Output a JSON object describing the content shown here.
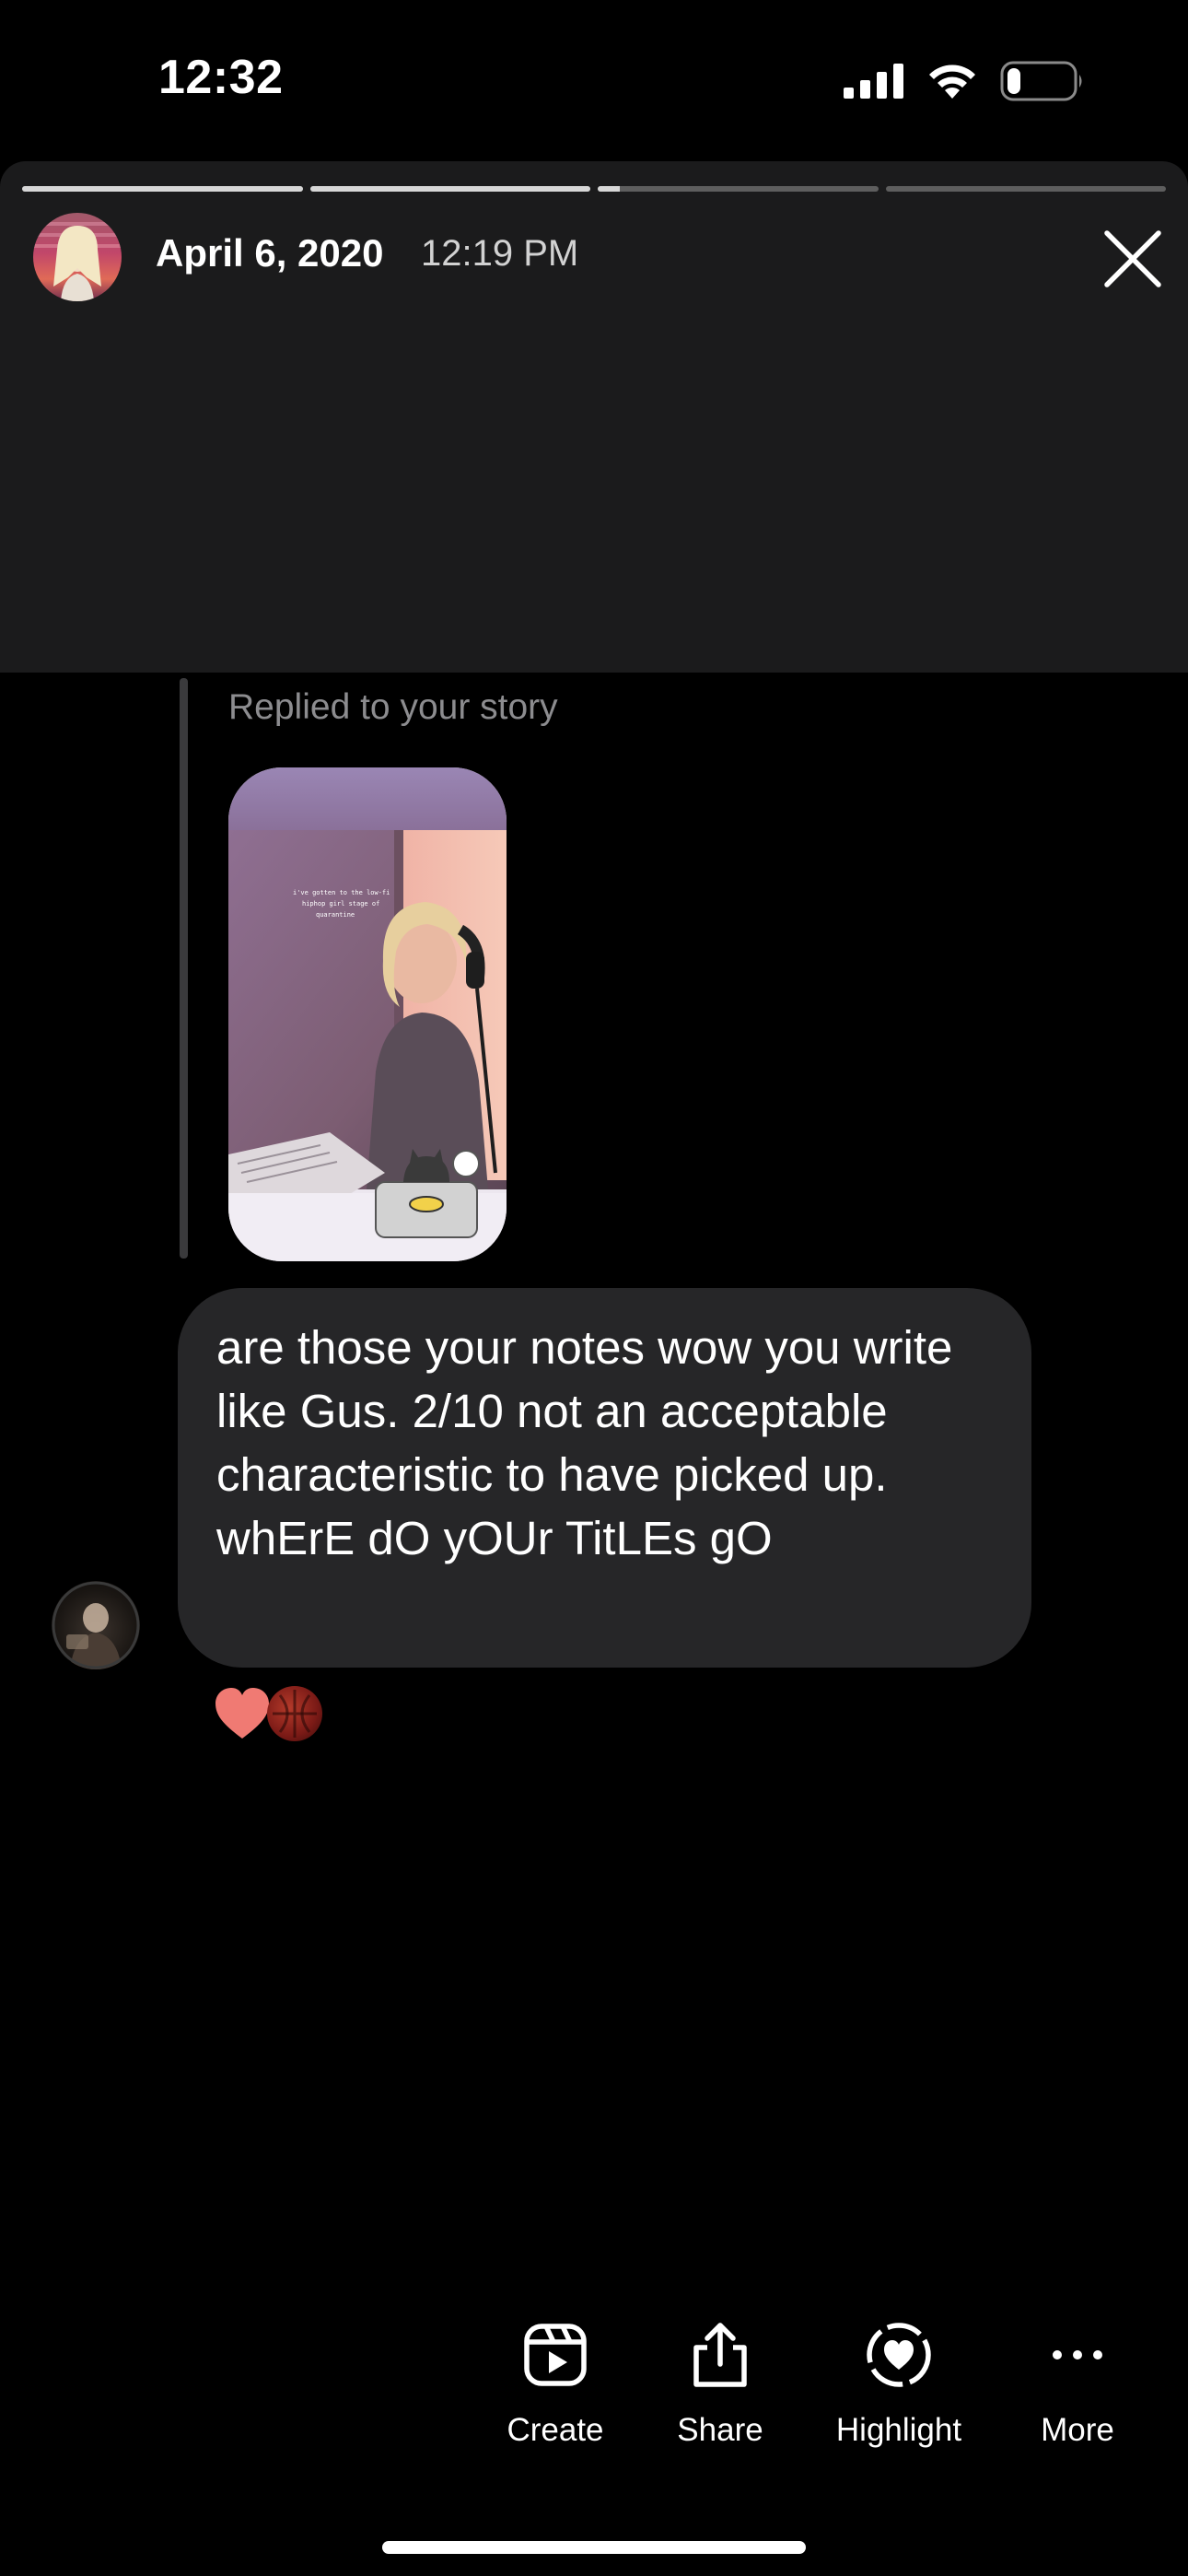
{
  "status_bar": {
    "time": "12:32",
    "icons": [
      "cellular-signal-icon",
      "wifi-icon",
      "battery-icon"
    ],
    "battery_level": 0.2
  },
  "story": {
    "progress_segments": [
      1.0,
      1.0,
      0.08,
      0.0
    ],
    "date": "April 6, 2020",
    "time": "12:19 PM",
    "close_icon": "close-icon"
  },
  "conversation": {
    "replied_label": "Replied to your story",
    "story_thumbnail_caption": "i've gotten to the low-fi hiphop girl stage of quarantine",
    "message_text": "are those your notes wow you write like Gus. 2/10 not an acceptable characteristic to have picked up. whErE dO yOUr TitLEs gO",
    "reactions": [
      "heart-icon",
      "reactor-avatar"
    ]
  },
  "toolbar": {
    "create": "Create",
    "share": "Share",
    "highlight": "Highlight",
    "more": "More"
  },
  "colors": {
    "background": "#000000",
    "story_card": "#1b1b1c",
    "bubble": "#262628",
    "heart": "#f07a73",
    "muted_text": "#8c8c8f"
  }
}
